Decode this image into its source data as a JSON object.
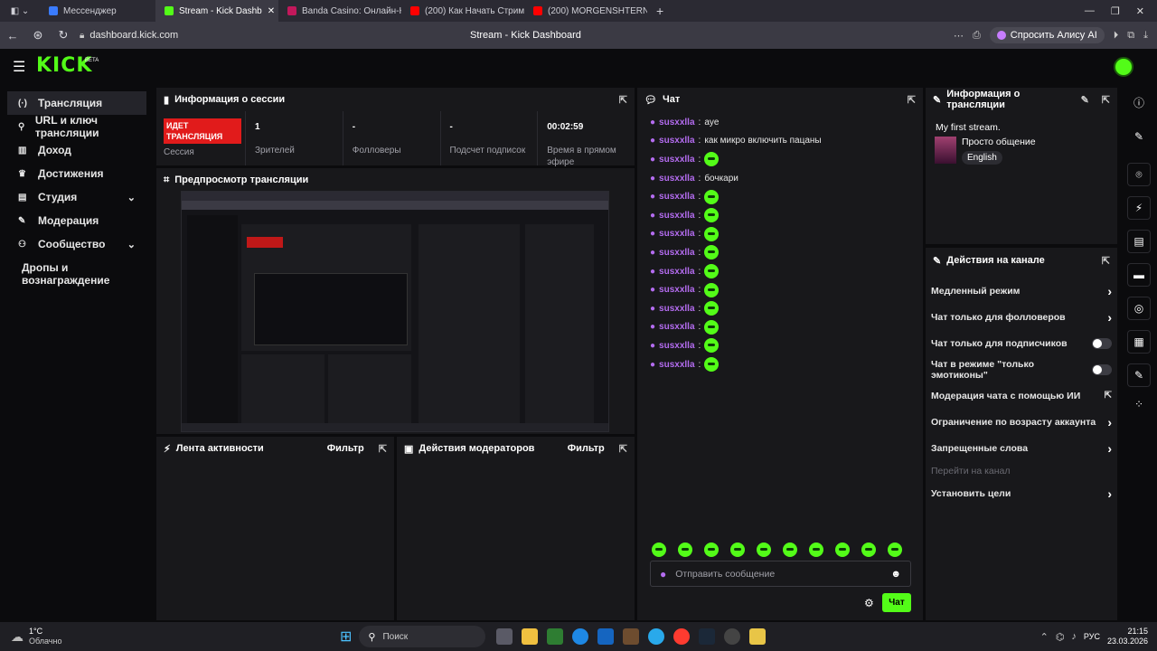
{
  "browser": {
    "tabs": [
      {
        "label": "Мессенджер",
        "color": "#3a7bfd"
      },
      {
        "label": "Stream - Kick Dashb",
        "color": "#53fc18",
        "active": true
      },
      {
        "label": "Banda Casino: Онлайн-Ка",
        "color": "#c2185b"
      },
      {
        "label": "(200) Как Начать Стрими",
        "color": "#ff0000"
      },
      {
        "label": "(200) MORGENSHTERN",
        "color": "#ff0000"
      }
    ],
    "url": "dashboard.kick.com",
    "page_title": "Stream - Kick Dashboard",
    "alice_label": "Спросить Алису AI"
  },
  "header": {
    "logo": "KICK",
    "logo_badge": "BETA"
  },
  "sidebar": {
    "items": [
      {
        "label": "Трансляция",
        "icon": "(·)",
        "active": true
      },
      {
        "label": "URL и ключ трансляции",
        "icon": "⚲"
      },
      {
        "label": "Доход",
        "icon": "▥"
      },
      {
        "label": "Достижения",
        "icon": "♛"
      },
      {
        "label": "Студия",
        "icon": "▤",
        "chevron": true
      },
      {
        "label": "Модерация",
        "icon": "✎"
      },
      {
        "label": "Сообщество",
        "icon": "⚇",
        "chevron": true
      }
    ],
    "extra": "Дропы и вознаграждение"
  },
  "session": {
    "title": "Информация о сессии",
    "live_badge": "ИДЕТ ТРАНСЛЯЦИЯ",
    "session_label": "Сессия",
    "stats": [
      {
        "value": "1",
        "label": "Зрителей"
      },
      {
        "value": "-",
        "label": "Фолловеры"
      },
      {
        "value": "-",
        "label": "Подсчет подписок"
      },
      {
        "value": "00:02:59",
        "label": "Время в прямом эфире"
      }
    ]
  },
  "preview": {
    "title": "Предпросмотр трансляции"
  },
  "activity": {
    "title": "Лента активности",
    "filter": "Фильтр"
  },
  "modactions": {
    "title": "Действия модераторов",
    "filter": "Фильтр"
  },
  "chat": {
    "title": "Чат",
    "messages": [
      {
        "user": "susxxlla",
        "text": "aye"
      },
      {
        "user": "susxxlla",
        "text": "как микро включить пацаны"
      },
      {
        "user": "susxxlla",
        "emote": true
      },
      {
        "user": "susxxlla",
        "text": "бочкари"
      },
      {
        "user": "susxxlla",
        "emote": true
      },
      {
        "user": "susxxlla",
        "emote": true
      },
      {
        "user": "susxxlla",
        "emote": true
      },
      {
        "user": "susxxlla",
        "emote": true
      },
      {
        "user": "susxxlla",
        "emote": true
      },
      {
        "user": "susxxlla",
        "emote": true
      },
      {
        "user": "susxxlla",
        "emote": true
      },
      {
        "user": "susxxlla",
        "emote": true
      },
      {
        "user": "susxxlla",
        "emote": true
      },
      {
        "user": "susxxlla",
        "emote": true
      }
    ],
    "input_placeholder": "Отправить сообщение",
    "send_label": "Чат"
  },
  "stream_info": {
    "title": "Информация о трансляции",
    "stream_title": "My first stream.",
    "category": "Просто общение",
    "language": "English"
  },
  "channel_actions": {
    "title": "Действия на канале",
    "items": [
      {
        "label": "Медленный режим",
        "type": "chevron"
      },
      {
        "label": "Чат только для фолловеров",
        "type": "chevron"
      },
      {
        "label": "Чат только для подписчиков",
        "type": "toggle"
      },
      {
        "label": "Чат в режиме \"только эмотиконы\"",
        "type": "toggle"
      },
      {
        "label": "Модерация чата с помощью ИИ",
        "type": "external"
      },
      {
        "label": "Ограничение по возрасту аккаунта",
        "type": "chevron"
      },
      {
        "label": "Запрещенные слова",
        "type": "chevron"
      },
      {
        "label": "Перейти на канал",
        "type": "disabled"
      },
      {
        "label": "Установить цели",
        "type": "chevron"
      }
    ]
  },
  "taskbar": {
    "weather_temp": "1°C",
    "weather_text": "Облачно",
    "search_label": "Поиск",
    "lang": "РУС",
    "time": "21:15",
    "date": "23.03.2026"
  }
}
